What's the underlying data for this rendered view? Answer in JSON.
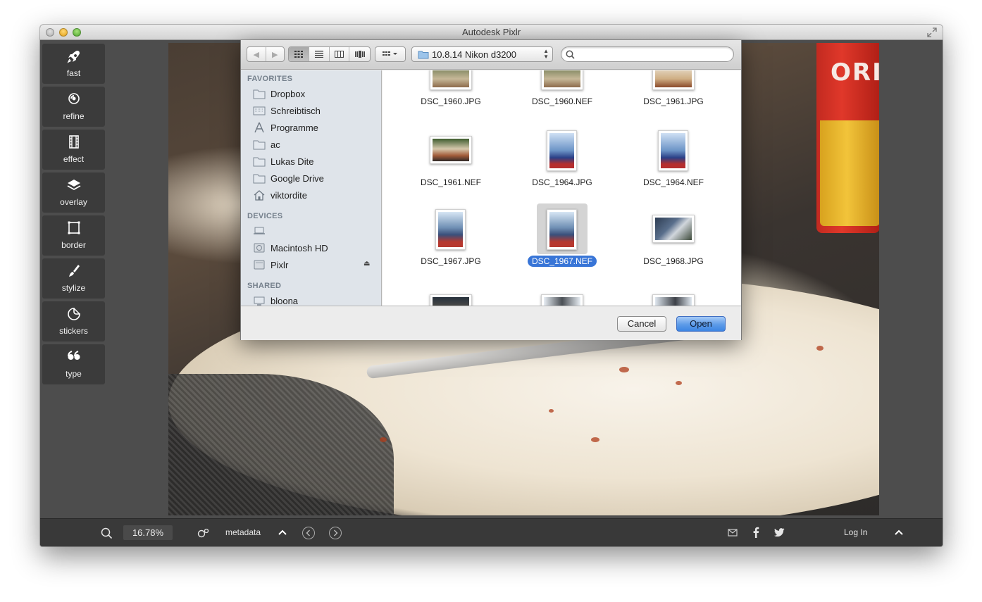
{
  "window": {
    "title": "Autodesk Pixlr"
  },
  "tools": [
    {
      "label": "fast",
      "icon": "rocket-icon"
    },
    {
      "label": "refine",
      "icon": "refine-icon"
    },
    {
      "label": "effect",
      "icon": "film-icon"
    },
    {
      "label": "overlay",
      "icon": "layers-icon"
    },
    {
      "label": "border",
      "icon": "border-icon"
    },
    {
      "label": "stylize",
      "icon": "brush-icon"
    },
    {
      "label": "stickers",
      "icon": "sticker-icon"
    },
    {
      "label": "type",
      "icon": "quote-icon"
    }
  ],
  "photo": {
    "can_text": "ORI"
  },
  "dialog": {
    "path": "10.8.14 Nikon d3200",
    "search_placeholder": "",
    "sidebar": {
      "favorites_header": "FAVORITES",
      "favorites": [
        "Dropbox",
        "Schreibtisch",
        "Programme",
        "ac",
        "Lukas Dite",
        "Google Drive",
        "viktordite"
      ],
      "devices_header": "DEVICES",
      "devices": [
        "",
        "Macintosh HD",
        "Pixlr"
      ],
      "shared_header": "SHARED",
      "shared": [
        "bloona"
      ]
    },
    "files": [
      {
        "name": "DSC_1960.JPG",
        "kind": "food"
      },
      {
        "name": "DSC_1960.NEF",
        "kind": "food"
      },
      {
        "name": "DSC_1961.JPG",
        "kind": "food"
      },
      {
        "name": "DSC_1961.NEF",
        "kind": "food"
      },
      {
        "name": "DSC_1964.JPG",
        "kind": "kid"
      },
      {
        "name": "DSC_1964.NEF",
        "kind": "kid"
      },
      {
        "name": "DSC_1967.JPG",
        "kind": "kid"
      },
      {
        "name": "DSC_1967.NEF",
        "kind": "kid",
        "selected": true
      },
      {
        "name": "DSC_1968.JPG",
        "kind": "people"
      }
    ],
    "cancel_label": "Cancel",
    "open_label": "Open"
  },
  "bottom": {
    "zoom": "16.78%",
    "metadata_label": "metadata",
    "login_label": "Log In"
  }
}
